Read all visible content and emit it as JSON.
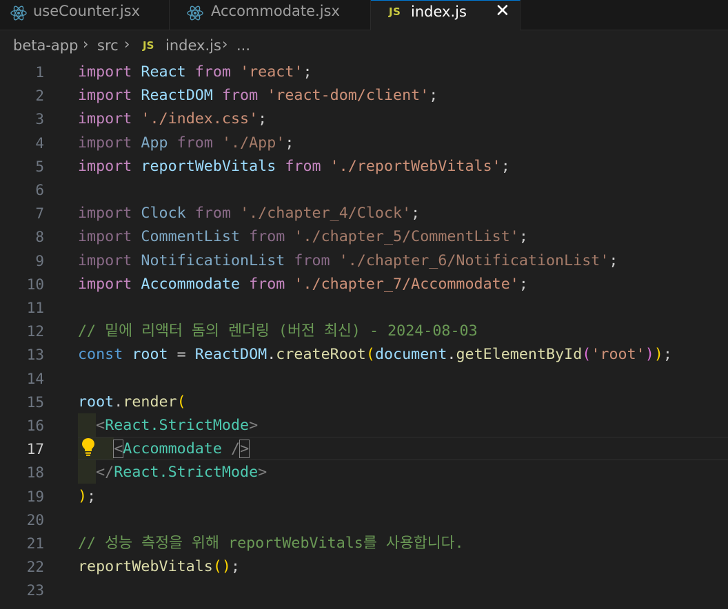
{
  "tabs": [
    {
      "label": "useCounter.jsx",
      "icon": "react-icon",
      "active": false
    },
    {
      "label": "Accommodate.jsx",
      "icon": "react-icon",
      "active": false
    },
    {
      "label": "index.js",
      "icon": "js-file-icon",
      "badge": "JS",
      "active": true
    }
  ],
  "breadcrumb": {
    "parts": [
      "beta-app",
      "src",
      "index.js",
      "..."
    ],
    "js_badge": "JS",
    "separator": ">"
  },
  "editor": {
    "current_line": 17,
    "line_numbers": [
      "1",
      "2",
      "3",
      "4",
      "5",
      "6",
      "7",
      "8",
      "9",
      "10",
      "11",
      "12",
      "13",
      "14",
      "15",
      "16",
      "17",
      "18",
      "19",
      "20",
      "21",
      "22",
      "23"
    ],
    "lines": [
      [
        "import",
        " ",
        "React",
        " ",
        "from",
        " ",
        "'react'",
        ";"
      ],
      [
        "import",
        " ",
        "ReactDOM",
        " ",
        "from",
        " ",
        "'react-dom/client'",
        ";"
      ],
      [
        "import",
        " ",
        "'./index.css'",
        ";"
      ],
      [
        "import",
        " ",
        "App",
        " ",
        "from",
        " ",
        "'./App'",
        ";"
      ],
      [
        "import",
        " ",
        "reportWebVitals",
        " ",
        "from",
        " ",
        "'./reportWebVitals'",
        ";"
      ],
      [],
      [
        "import",
        " ",
        "Clock",
        " ",
        "from",
        " ",
        "'./chapter_4/Clock'",
        ";"
      ],
      [
        "import",
        " ",
        "CommentList",
        " ",
        "from",
        " ",
        "'./chapter_5/CommentList'",
        ";"
      ],
      [
        "import",
        " ",
        "NotificationList",
        " ",
        "from",
        " ",
        "'./chapter_6/NotificationList'",
        ";"
      ],
      [
        "import",
        " ",
        "Accommodate",
        " ",
        "from",
        " ",
        "'./chapter_7/Accommodate'",
        ";"
      ],
      [],
      [
        "// 밑에 리액터 돔의 렌더링 (버전 최신) - 2024-08-03"
      ],
      [
        "const",
        " ",
        "root",
        " = ",
        "ReactDOM",
        ".",
        "createRoot",
        "(",
        "document",
        ".",
        "getElementById",
        "(",
        "'root'",
        ")",
        ")",
        ";"
      ],
      [],
      [
        "root",
        ".",
        "render",
        "("
      ],
      [
        "  ",
        "<",
        "React.StrictMode",
        ">"
      ],
      [
        "    ",
        "<",
        "Accommodate",
        " /",
        ">"
      ],
      [
        "  ",
        "</",
        "React.StrictMode",
        ">"
      ],
      [
        ")",
        ";"
      ],
      [],
      [
        "// 성능 측정을 위해 reportWebVitals를 사용합니다."
      ],
      [
        "reportWebVitals",
        "(",
        ")",
        ";"
      ],
      []
    ]
  },
  "colors": {
    "keyword": "#c586c0",
    "identifier": "#9cdcfe",
    "string": "#ce9178",
    "comment": "#6a9955",
    "const": "#569cd6",
    "function": "#dcdcaa",
    "component": "#4ec9b0",
    "bracket_gold": "#ffd700",
    "bracket_violet": "#da70d6",
    "accent": "#0078d4",
    "js_badge": "#cbcb41"
  }
}
